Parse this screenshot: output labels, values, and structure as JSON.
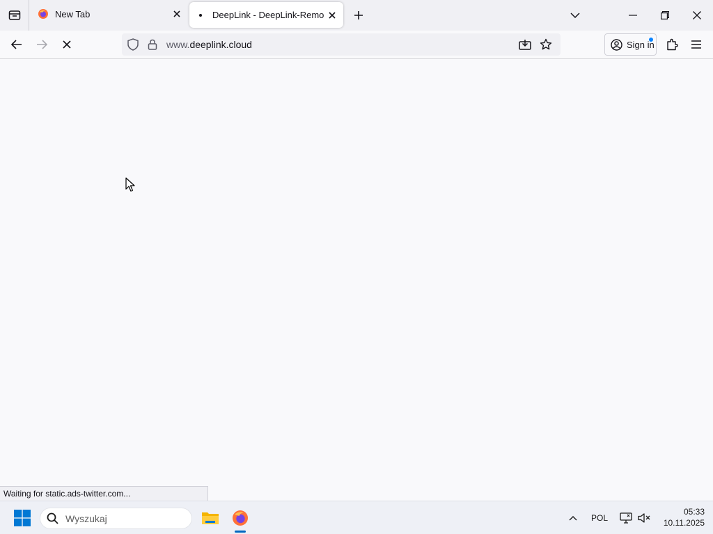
{
  "browser": {
    "tabs": [
      {
        "title": "New Tab",
        "icon": "firefox-icon",
        "active": false
      },
      {
        "title": "DeepLink - DeepLink-Remote C",
        "icon": "loading-dot-icon",
        "active": true
      }
    ],
    "url": {
      "prefix": "www.",
      "host": "deeplink.cloud"
    },
    "signin_label": "Sign in",
    "status_text": "Waiting for static.ads-twitter.com..."
  },
  "taskbar": {
    "search_placeholder": "Wyszukaj",
    "language": "POL",
    "time": "05:33",
    "date": "10.11.2025"
  },
  "colors": {
    "accent": "#0a84ff",
    "taskbar_accent": "#0067c0"
  }
}
